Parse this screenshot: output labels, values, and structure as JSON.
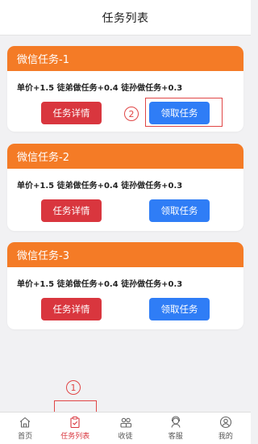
{
  "header": {
    "title": "任务列表"
  },
  "tasks": [
    {
      "title": "微信任务-1",
      "desc": "单价+1.5 徒弟做任务+0.4 徒孙做任务+0.3",
      "detail_label": "任务详情",
      "claim_label": "领取任务"
    },
    {
      "title": "微信任务-2",
      "desc": "单价+1.5 徒弟做任务+0.4 徒孙做任务+0.3",
      "detail_label": "任务详情",
      "claim_label": "领取任务"
    },
    {
      "title": "微信任务-3",
      "desc": "单价+1.5 徒弟做任务+0.4 徒孙做任务+0.3",
      "detail_label": "任务详情",
      "claim_label": "领取任务"
    }
  ],
  "annotations": {
    "marker1": "1",
    "marker2": "2"
  },
  "tabbar": {
    "items": [
      {
        "label": "首页",
        "icon": "home-icon"
      },
      {
        "label": "任务列表",
        "icon": "clipboard-icon",
        "active": true
      },
      {
        "label": "收徒",
        "icon": "users-icon"
      },
      {
        "label": "客服",
        "icon": "headset-icon"
      },
      {
        "label": "我的",
        "icon": "user-icon"
      }
    ]
  },
  "colors": {
    "accent_orange": "#f47b26",
    "detail_red": "#d9363e",
    "claim_blue": "#2f7df6",
    "annotation_red": "#e04646"
  }
}
